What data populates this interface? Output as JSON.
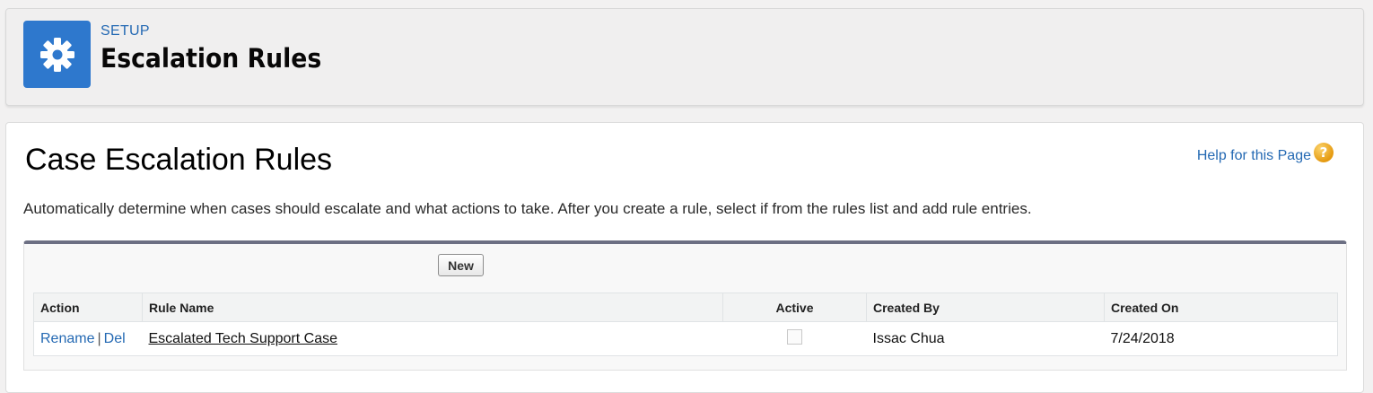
{
  "header": {
    "breadcrumb": "SETUP",
    "title": "Escalation Rules",
    "icon": "gear-icon",
    "icon_bg_color": "#2e78cd"
  },
  "main": {
    "section_title": "Case Escalation Rules",
    "help_link": "Help for this Page",
    "help_icon": "?",
    "description": "Automatically determine when cases should escalate and what actions to take. After you create a rule, select if from the rules list and add rule entries.",
    "new_button": "New",
    "table": {
      "columns": [
        "Action",
        "Rule Name",
        "Active",
        "Created By",
        "Created On"
      ],
      "rows": [
        {
          "actions": [
            "Rename",
            "Del"
          ],
          "separator": "|",
          "rule_name": "Escalated Tech Support Case",
          "active": false,
          "created_by": "Issac Chua",
          "created_on": "7/24/2018"
        }
      ]
    }
  },
  "colors": {
    "link": "#2469b3",
    "panel_top_border": "#6c6f83",
    "help_icon": "#e59a10"
  }
}
